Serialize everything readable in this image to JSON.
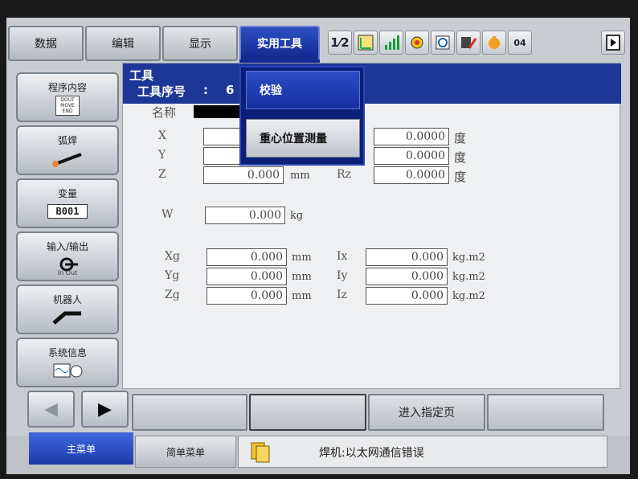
{
  "top_tabs": [
    {
      "label": "数据",
      "active": false
    },
    {
      "label": "编辑",
      "active": false
    },
    {
      "label": "显示",
      "active": false
    },
    {
      "label": "实用工具",
      "active": true
    }
  ],
  "toolbar_icons": [
    "coordinate-icon",
    "frame-icon",
    "signal-icon",
    "gear-icon",
    "timer-icon",
    "edit-icon",
    "hand-icon",
    "tool-icon",
    "play-icon"
  ],
  "toolbar_text": {
    "coord": "1⁄2",
    "tool": "04"
  },
  "sidebar": [
    {
      "label": "程序内容",
      "icon_text": "DOUT MOVE END"
    },
    {
      "label": "弧焊",
      "icon_text": ""
    },
    {
      "label": "变量",
      "icon_text": "B001"
    },
    {
      "label": "输入/输出",
      "icon_text": "In  Out"
    },
    {
      "label": "机器人",
      "icon_text": ""
    },
    {
      "label": "系统信息",
      "icon_text": ""
    }
  ],
  "header": {
    "title": "工具",
    "tool_no_label": "工具序号",
    "colon": ":",
    "tool_no_value": "6"
  },
  "name_label": "名称",
  "dropdown": [
    {
      "label": "校验"
    },
    {
      "label": "重心位置测量"
    }
  ],
  "fields": {
    "X": {
      "label": "X",
      "value": ""
    },
    "Y": {
      "label": "Y",
      "value": ""
    },
    "Z": {
      "label": "Z",
      "value": "0.000",
      "unit": "mm"
    },
    "Rx": {
      "label": "",
      "value": "0.0000",
      "unit": "度"
    },
    "Ry": {
      "label": "",
      "value": "0.0000",
      "unit": "度"
    },
    "Rz": {
      "label": "Rz",
      "value": "0.0000",
      "unit": "度"
    },
    "W": {
      "label": "W",
      "value": "0.000",
      "unit": "kg"
    },
    "Xg": {
      "label": "Xg",
      "value": "0.000",
      "unit": "mm"
    },
    "Yg": {
      "label": "Yg",
      "value": "0.000",
      "unit": "mm"
    },
    "Zg": {
      "label": "Zg",
      "value": "0.000",
      "unit": "mm"
    },
    "Ix": {
      "label": "Ix",
      "value": "0.000",
      "unit": "kg.m2"
    },
    "Iy": {
      "label": "Iy",
      "value": "0.000",
      "unit": "kg.m2"
    },
    "Iz": {
      "label": "Iz",
      "value": "0.000",
      "unit": "kg.m2"
    }
  },
  "bottom_actions": [
    "",
    "",
    "进入指定页",
    ""
  ],
  "nav": {
    "back": "◀",
    "forward": "▶"
  },
  "status": {
    "main_menu": "主菜单",
    "simple_menu": "简单菜单",
    "message": "焊机:以太网通信错误"
  }
}
